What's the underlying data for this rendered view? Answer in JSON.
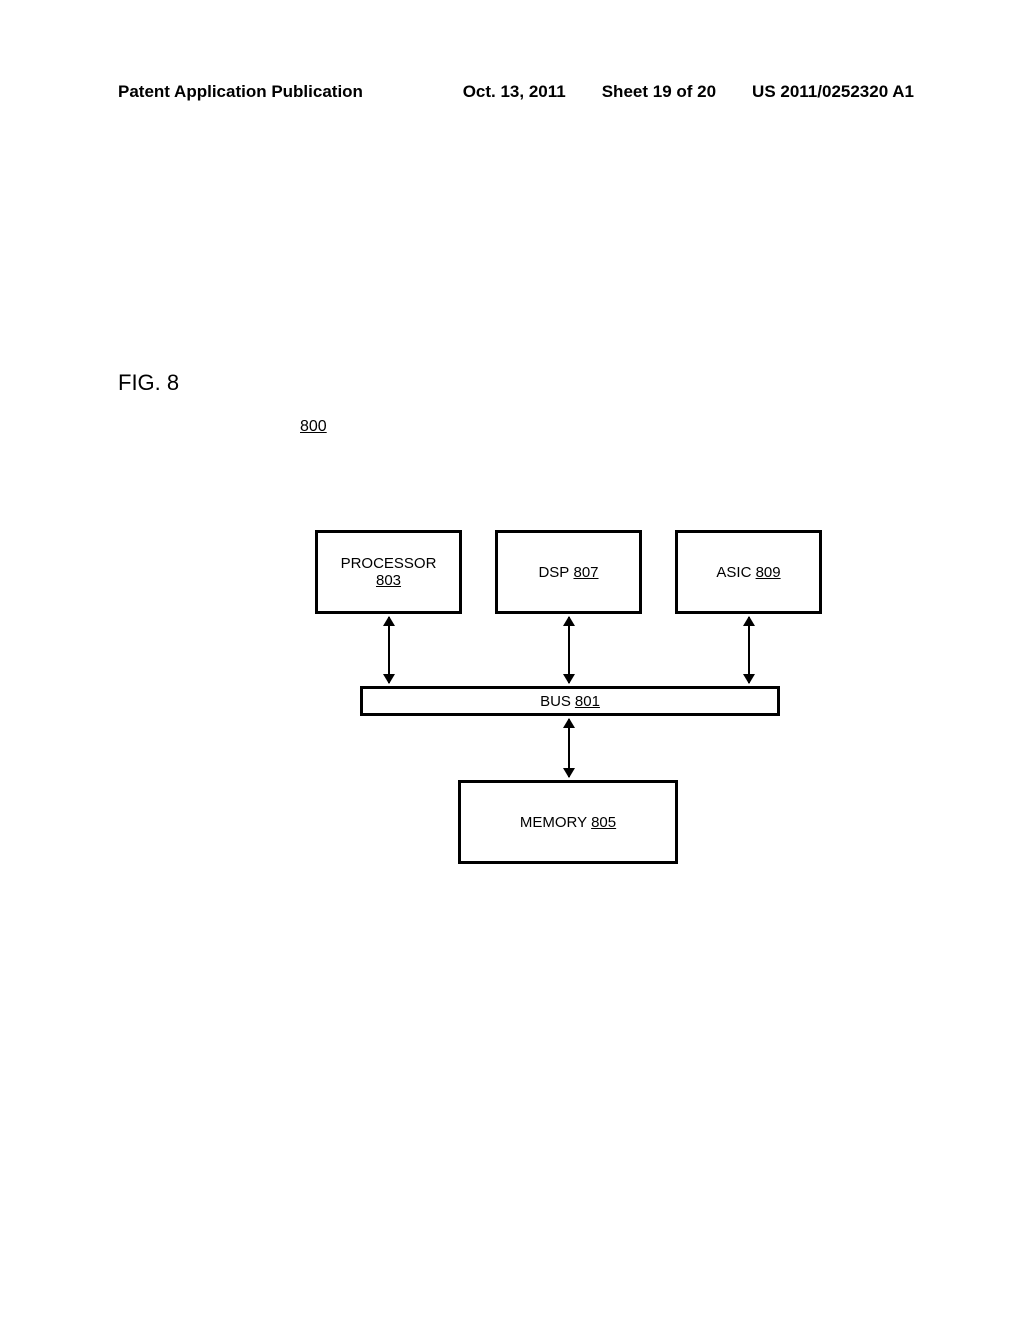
{
  "header": {
    "left": "Patent Application Publication",
    "date": "Oct. 13, 2011",
    "sheet": "Sheet 19 of 20",
    "pubno": "US 2011/0252320 A1"
  },
  "figure": {
    "label": "FIG. 8",
    "ref": "800"
  },
  "blocks": {
    "processor": {
      "label": "PROCESSOR",
      "ref": "803"
    },
    "dsp": {
      "label": "DSP",
      "ref": "807"
    },
    "asic": {
      "label": "ASIC",
      "ref": "809"
    },
    "bus": {
      "label": "BUS",
      "ref": "801"
    },
    "memory": {
      "label": "MEMORY",
      "ref": "805"
    }
  }
}
